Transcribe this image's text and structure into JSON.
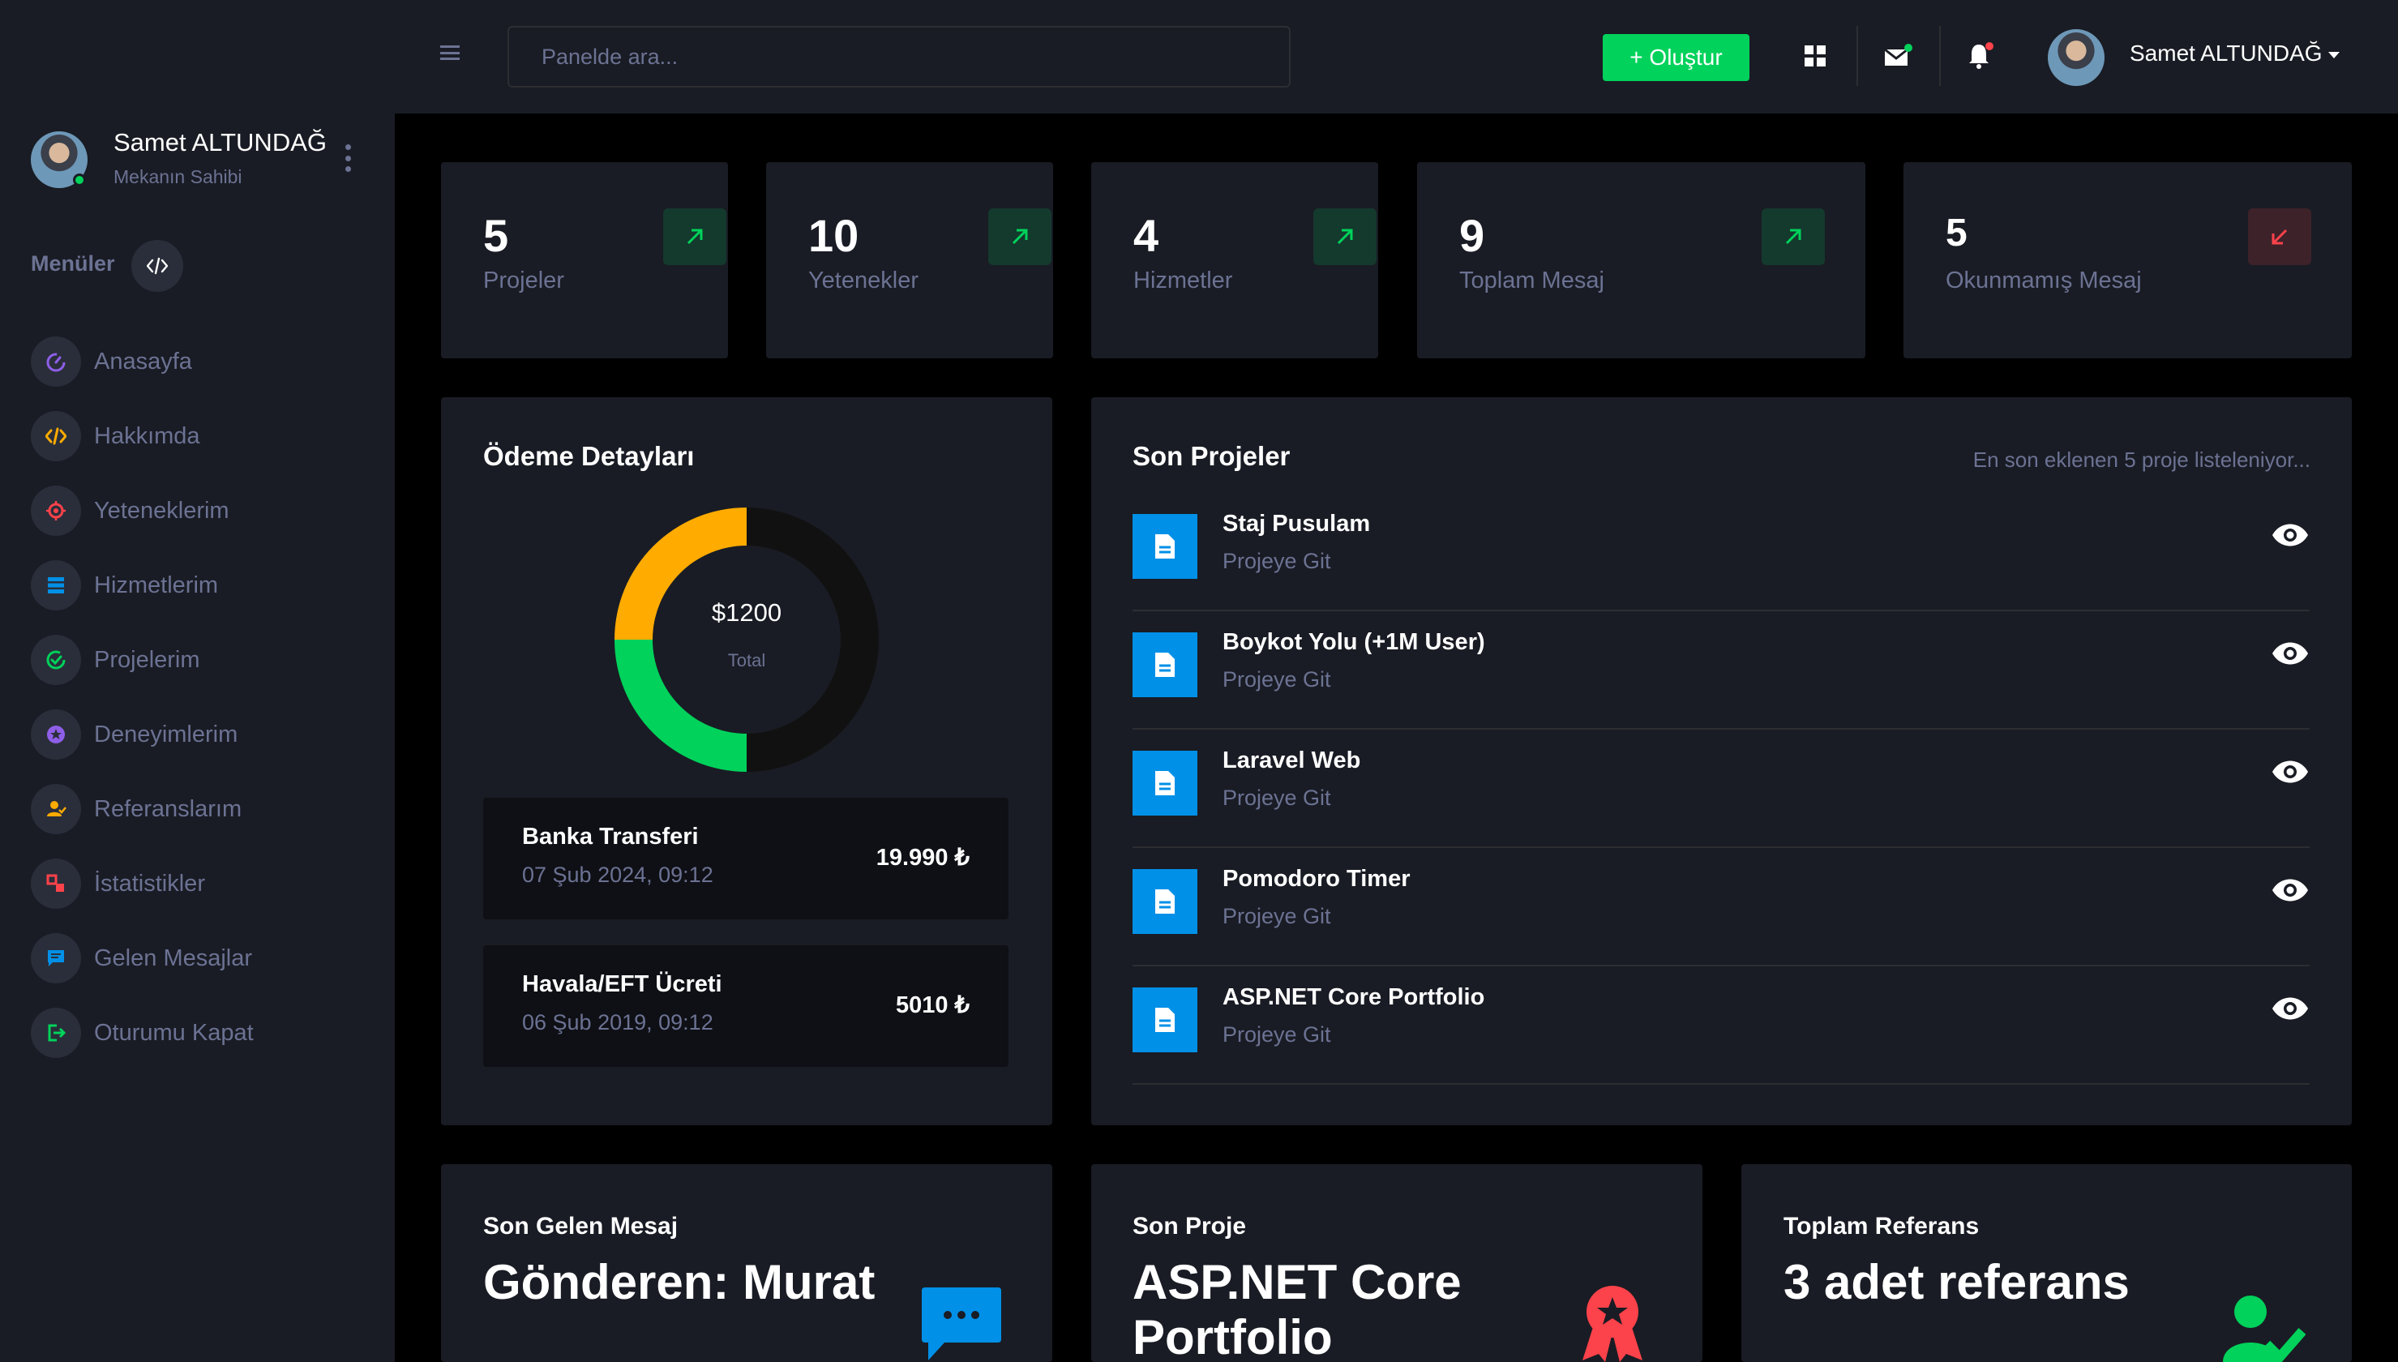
{
  "profile": {
    "name": "Samet ALTUNDAĞ",
    "role": "Mekanın Sahibi"
  },
  "sidebar": {
    "menu_title": "Menüler",
    "items": [
      {
        "label": "Anasayfa",
        "icon": "speedometer-icon",
        "color": "#8f5fe8"
      },
      {
        "label": "Hakkımda",
        "icon": "code-icon",
        "color": "#ffab00"
      },
      {
        "label": "Yeteneklerim",
        "icon": "target-icon",
        "color": "#fc424a"
      },
      {
        "label": "Hizmetlerim",
        "icon": "server-icon",
        "color": "#0090e7"
      },
      {
        "label": "Projelerim",
        "icon": "check-circle-icon",
        "color": "#00d25b"
      },
      {
        "label": "Deneyimlerim",
        "icon": "star-circle-icon",
        "color": "#8f5fe8"
      },
      {
        "label": "Referanslarım",
        "icon": "user-check-icon",
        "color": "#ffab00"
      },
      {
        "label": "İstatistikler",
        "icon": "chart-icon",
        "color": "#fc424a"
      },
      {
        "label": "Gelen Mesajlar",
        "icon": "message-icon",
        "color": "#0090e7"
      },
      {
        "label": "Oturumu Kapat",
        "icon": "logout-icon",
        "color": "#00d25b"
      }
    ]
  },
  "topbar": {
    "search_placeholder": "Panelde ara...",
    "create_label": "+ Oluştur",
    "user_name": "Samet ALTUNDAĞ"
  },
  "stats": [
    {
      "value": "5",
      "label": "Projeler",
      "trend": "up"
    },
    {
      "value": "10",
      "label": "Yetenekler",
      "trend": "up"
    },
    {
      "value": "4",
      "label": "Hizmetler",
      "trend": "up"
    },
    {
      "value": "9",
      "label": "Toplam Mesaj",
      "trend": "up"
    },
    {
      "value": "5",
      "label": "Okunmamış Mesaj",
      "trend": "down"
    }
  ],
  "payment": {
    "title": "Ödeme Detayları",
    "total_value": "$1200",
    "total_label": "Total",
    "chart_data": {
      "type": "pie",
      "values": [
        50,
        25,
        25
      ],
      "colors": [
        "#111111",
        "#00d25b",
        "#ffab00"
      ]
    },
    "rows": [
      {
        "name": "Banka Transferi",
        "date": "07 Şub 2024, 09:12",
        "amount": "19.990 ₺"
      },
      {
        "name": "Havala/EFT Ücreti",
        "date": "06 Şub 2019, 09:12",
        "amount": "5010 ₺"
      }
    ]
  },
  "projects": {
    "title": "Son Projeler",
    "subtitle": "En son eklenen 5 proje listeleniyor...",
    "items": [
      {
        "name": "Staj Pusulam",
        "link": "Projeye Git"
      },
      {
        "name": "Boykot Yolu (+1M User)",
        "link": "Projeye Git"
      },
      {
        "name": "Laravel Web",
        "link": "Projeye Git"
      },
      {
        "name": "Pomodoro Timer",
        "link": "Projeye Git"
      },
      {
        "name": "ASP.NET Core Portfolio",
        "link": "Projeye Git"
      }
    ]
  },
  "bottom": {
    "message": {
      "subtitle": "Son Gelen Mesaj",
      "big": "Gönderen: Murat"
    },
    "project": {
      "subtitle": "Son Proje",
      "big": "ASP.NET Core Portfolio"
    },
    "reference": {
      "subtitle": "Toplam Referans",
      "big": "3 adet referans"
    }
  },
  "colors": {
    "accent_green": "#00d25b",
    "accent_red": "#fc424a",
    "accent_blue": "#0090e7",
    "accent_yellow": "#ffab00",
    "muted": "#6c7293",
    "card_bg": "#191c24"
  }
}
